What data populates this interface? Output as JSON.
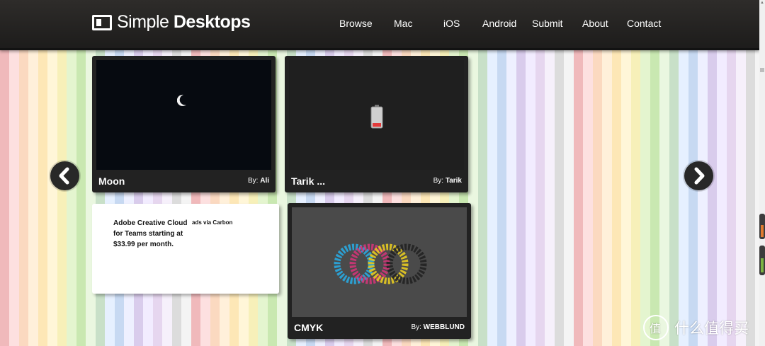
{
  "header": {
    "logo_regular": "Simple ",
    "logo_bold": "Desktops",
    "nav": [
      "Browse",
      "Mac",
      "iOS",
      "Android",
      "Submit",
      "About",
      "Contact"
    ]
  },
  "cards": [
    {
      "title": "Moon",
      "by_label": "By:",
      "author": "Ali",
      "thumb_icon": "moon-icon"
    },
    {
      "title": "Tarik ...",
      "by_label": "By:",
      "author": "Tarik",
      "thumb_icon": "battery-icon"
    },
    {
      "title": "CMYK",
      "by_label": "By:",
      "author": "WEBBLUND",
      "thumb_icon": "cmyk-circles"
    }
  ],
  "ad": {
    "text": "Adobe Creative Cloud for Teams starting at $33.99 per month.",
    "via": "ads via Carbon"
  },
  "watermark": {
    "text": "什么值得买"
  },
  "colors": {
    "header": "#2b2a28",
    "card": "#222222",
    "accent_red": "#e23a3a",
    "orange_gauge": "#e07a2e",
    "green_gauge": "#7cb342"
  },
  "icons": [
    "prev-arrow-icon",
    "next-arrow-icon",
    "moon-icon",
    "battery-icon",
    "logo-icon"
  ]
}
